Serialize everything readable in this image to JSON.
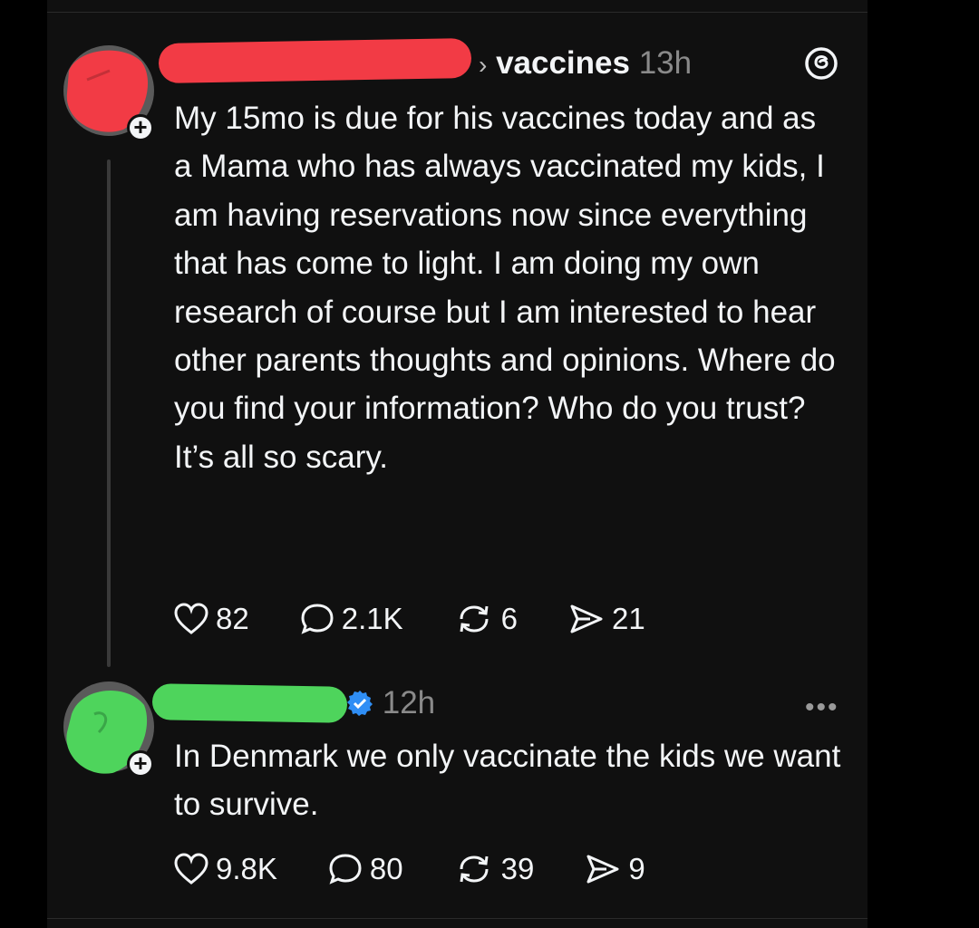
{
  "post": {
    "topic": "vaccines",
    "time": "13h",
    "text": "My 15mo is due for his vaccines today and as a Mama who has always vaccinated my kids, I am having reservations now since everything that has come to light. I am doing my own research of course but I am interested to hear other parents thoughts and opinions. Where do you find your information? Who do you trust? It’s all so scary.",
    "likes": "82",
    "replies": "2.1K",
    "reposts": "6",
    "shares": "21"
  },
  "reply": {
    "time": "12h",
    "text": "In Denmark we only vaccinate the kids we want to survive.",
    "likes": "9.8K",
    "replies": "80",
    "reposts": "39",
    "shares": "9"
  },
  "colors": {
    "redaction_red": "#f23b45",
    "redaction_green": "#4ed45c",
    "verified_blue": "#2f8ef5",
    "background": "#101010"
  },
  "icons": [
    "chevron-right-icon",
    "threads-logo-icon",
    "heart-icon",
    "comment-icon",
    "repost-icon",
    "share-icon",
    "verified-badge-icon",
    "more-icon",
    "plus-icon"
  ]
}
